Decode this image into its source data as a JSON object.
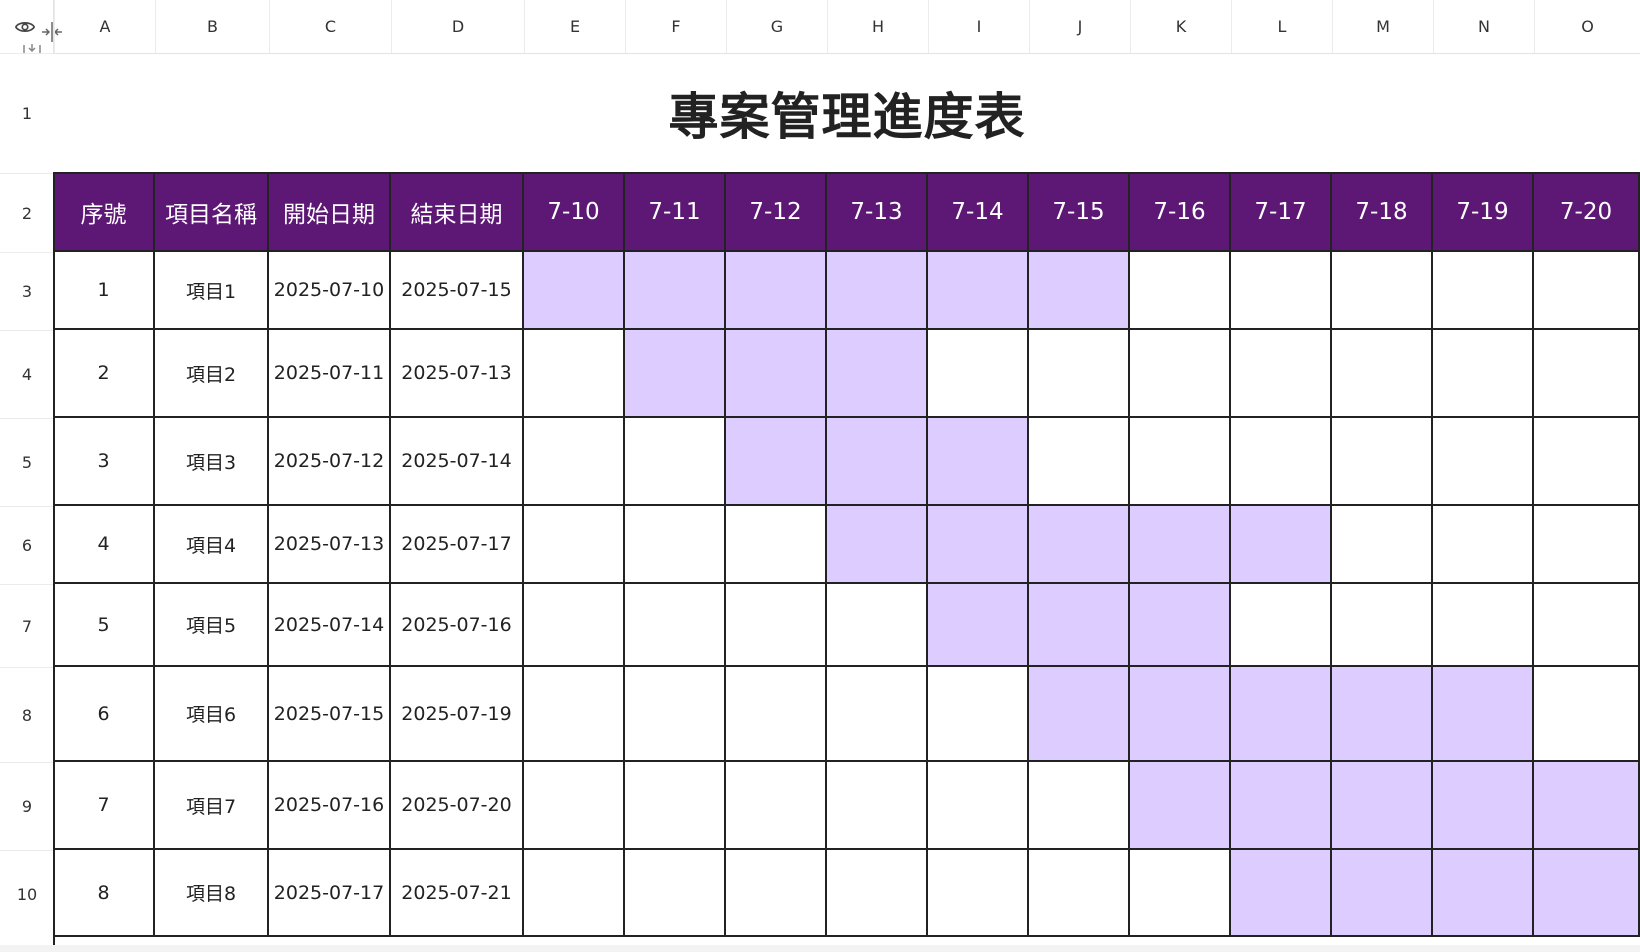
{
  "columns": [
    "A",
    "B",
    "C",
    "D",
    "E",
    "F",
    "G",
    "H",
    "I",
    "J",
    "K",
    "L",
    "M",
    "N",
    "O"
  ],
  "rows": [
    "1",
    "2",
    "3",
    "4",
    "5",
    "6",
    "7",
    "8",
    "9",
    "10"
  ],
  "title": "專案管理進度表",
  "headers": [
    "序號",
    "項目名稱",
    "開始日期",
    "結束日期",
    "7-10",
    "7-11",
    "7-12",
    "7-13",
    "7-14",
    "7-15",
    "7-16",
    "7-17",
    "7-18",
    "7-19",
    "7-20"
  ],
  "tasks": [
    {
      "seq": "1",
      "name": "項目1",
      "start": "2025-07-10",
      "end": "2025-07-15"
    },
    {
      "seq": "2",
      "name": "項目2",
      "start": "2025-07-11",
      "end": "2025-07-13"
    },
    {
      "seq": "3",
      "name": "項目3",
      "start": "2025-07-12",
      "end": "2025-07-14"
    },
    {
      "seq": "4",
      "name": "項目4",
      "start": "2025-07-13",
      "end": "2025-07-17"
    },
    {
      "seq": "5",
      "name": "項目5",
      "start": "2025-07-14",
      "end": "2025-07-16"
    },
    {
      "seq": "6",
      "name": "項目6",
      "start": "2025-07-15",
      "end": "2025-07-19"
    },
    {
      "seq": "7",
      "name": "項目7",
      "start": "2025-07-16",
      "end": "2025-07-20"
    },
    {
      "seq": "8",
      "name": "項目8",
      "start": "2025-07-17",
      "end": "2025-07-21"
    }
  ],
  "colors": {
    "header_bg": "#5d1774",
    "bar_fill": "#dcccff",
    "grid_line": "#222222"
  },
  "icons": {
    "corner_left": "eye-icon",
    "corner_right": "collapse-columns-icon",
    "corner_bottom": "collapse-rows-icon"
  }
}
